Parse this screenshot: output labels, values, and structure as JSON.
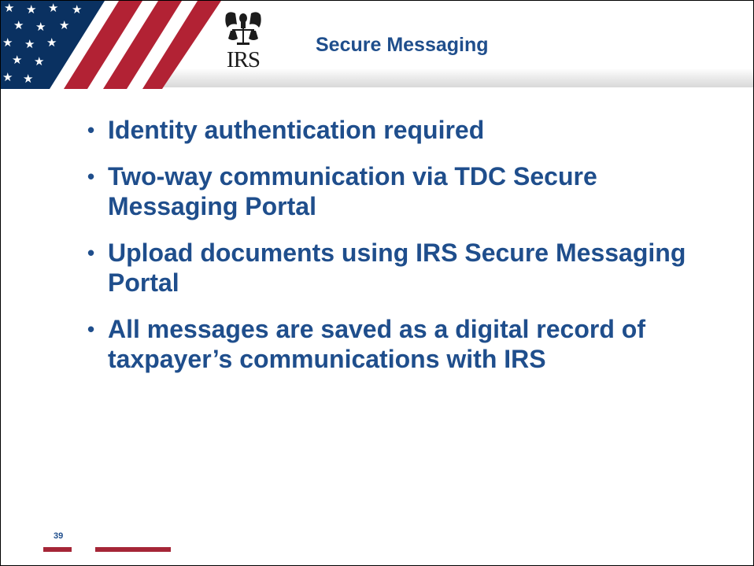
{
  "header": {
    "title": "Secure Messaging",
    "logo_text": "IRS"
  },
  "bullets": [
    "Identity authentication required",
    "Two-way communication via TDC Secure Messaging Portal",
    "Upload documents using IRS Secure Messaging Portal",
    "All messages are saved as a digital record of taxpayer’s communications with IRS"
  ],
  "bullet_symbol": "•",
  "footer": {
    "page_number": "39"
  },
  "colors": {
    "title_blue": "#1f4e8c",
    "flag_red": "#b22234",
    "flag_blue": "#0a3161",
    "footer_red": "#a52637"
  },
  "icons": {
    "logo": "irs-eagle-scales-icon",
    "flag": "us-flag-stars-stripes"
  }
}
